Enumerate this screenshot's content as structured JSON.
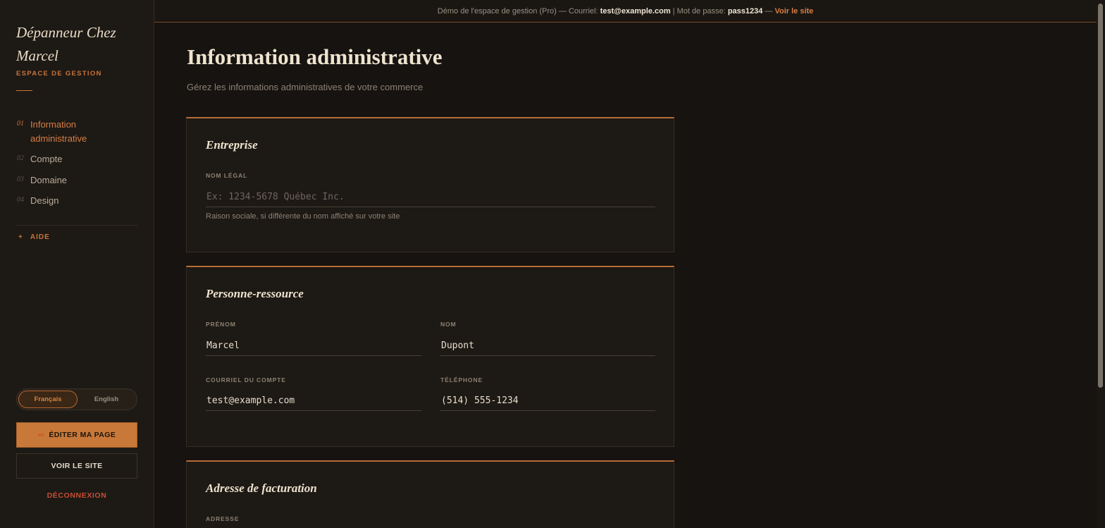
{
  "demo_bar": {
    "prefix": "Démo de l'espace de gestion (Pro) — Courriel: ",
    "email": "test@example.com",
    "middle": " | Mot de passe: ",
    "password": "pass1234",
    "dash": " — ",
    "link": "Voir le site"
  },
  "sidebar": {
    "brand": "Dépanneur Chez Marcel",
    "brand_sub": "ESPACE DE GESTION",
    "nav": [
      {
        "num": "01",
        "label": "Information administrative"
      },
      {
        "num": "02",
        "label": "Compte"
      },
      {
        "num": "03",
        "label": "Domaine"
      },
      {
        "num": "04",
        "label": "Design"
      }
    ],
    "help_icon": "+",
    "help_label": "AIDE",
    "lang_fr": "Français",
    "lang_en": "English",
    "edit_icon": "✏",
    "edit_label": "ÉDITER MA PAGE",
    "view_label": "VOIR LE SITE",
    "logout_label": "DÉCONNEXION"
  },
  "main": {
    "title": "Information administrative",
    "subtitle": "Gérez les informations administratives de votre commerce",
    "entreprise": {
      "title": "Entreprise",
      "legal_label": "NOM LÉGAL",
      "legal_placeholder": "Ex: 1234-5678 Québec Inc.",
      "legal_value": "",
      "legal_help": "Raison sociale, si différente du nom affiché sur votre site"
    },
    "contact": {
      "title": "Personne-ressource",
      "first_label": "PRÉNOM",
      "first_value": "Marcel",
      "last_label": "NOM",
      "last_value": "Dupont",
      "email_label": "COURRIEL DU COMPTE",
      "email_value": "test@example.com",
      "phone_label": "TÉLÉPHONE",
      "phone_value": "(514) 555-1234"
    },
    "billing": {
      "title": "Adresse de facturation",
      "address_label": "ADRESSE"
    }
  }
}
